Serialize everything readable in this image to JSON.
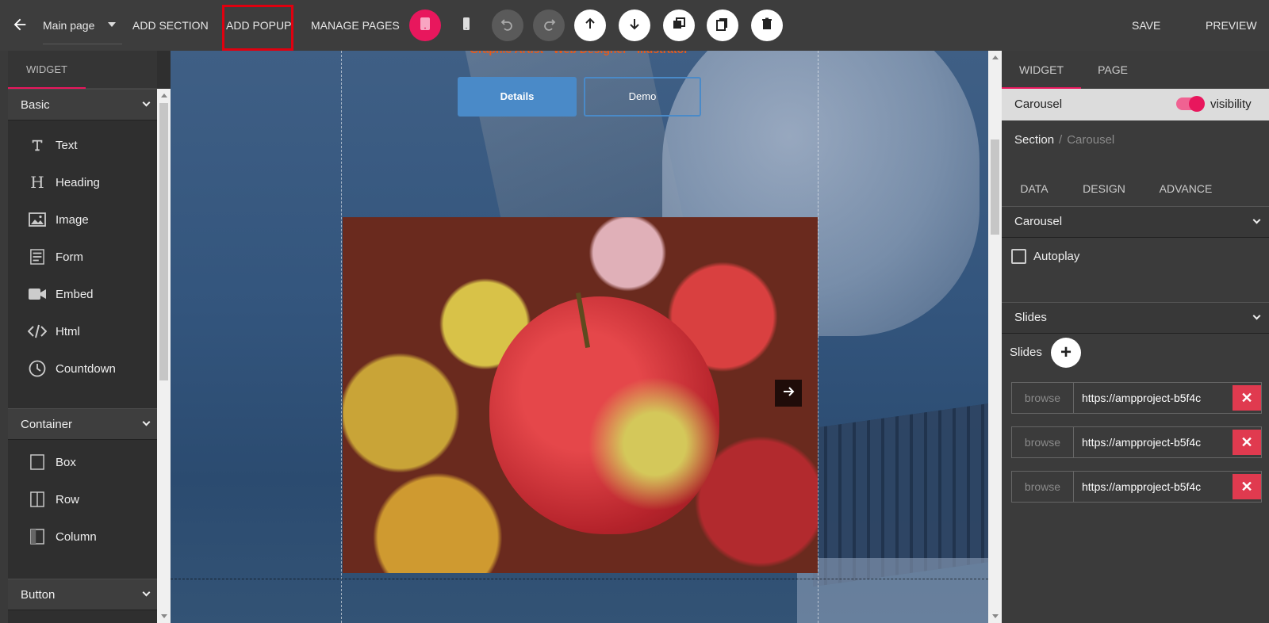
{
  "topbar": {
    "page_select_value": "Main page",
    "add_section": "ADD SECTION",
    "add_popup": "ADD POPUP",
    "manage_pages": "MANAGE PAGES",
    "save": "SAVE",
    "preview": "PREVIEW",
    "accent_color": "#e8175d",
    "highlight_color": "#e0000f"
  },
  "left_panel": {
    "tab": "WIDGET",
    "sections": [
      {
        "title": "Basic",
        "items": [
          {
            "label": "Text",
            "icon": "text-icon"
          },
          {
            "label": "Heading",
            "icon": "heading-icon"
          },
          {
            "label": "Image",
            "icon": "image-icon"
          },
          {
            "label": "Form",
            "icon": "form-icon"
          },
          {
            "label": "Embed",
            "icon": "video-icon"
          },
          {
            "label": "Html",
            "icon": "code-icon"
          },
          {
            "label": "Countdown",
            "icon": "clock-icon"
          }
        ]
      },
      {
        "title": "Container",
        "items": [
          {
            "label": "Box",
            "icon": "box-icon"
          },
          {
            "label": "Row",
            "icon": "row-icon"
          },
          {
            "label": "Column",
            "icon": "column-icon"
          }
        ]
      },
      {
        "title": "Button",
        "items": []
      }
    ]
  },
  "canvas": {
    "header_text": "Graphic Artist · Web Designer · Illustrator",
    "details_button": "Details",
    "demo_button": "Demo"
  },
  "right_panel": {
    "tabs": [
      "WIDGET",
      "PAGE"
    ],
    "component": "Carousel",
    "visibility_label": "visibility",
    "visibility_on": true,
    "breadcrumb": [
      "Section",
      "Carousel"
    ],
    "sub_tabs": [
      "DATA",
      "DESIGN",
      "ADVANCE"
    ],
    "carousel_header": "Carousel",
    "autoplay_label": "Autoplay",
    "autoplay_checked": false,
    "slides_header": "Slides",
    "slides_label": "Slides",
    "browse_label": "browse",
    "slides": [
      "https://ampproject-b5f4c",
      "https://ampproject-b5f4c",
      "https://ampproject-b5f4c"
    ]
  }
}
